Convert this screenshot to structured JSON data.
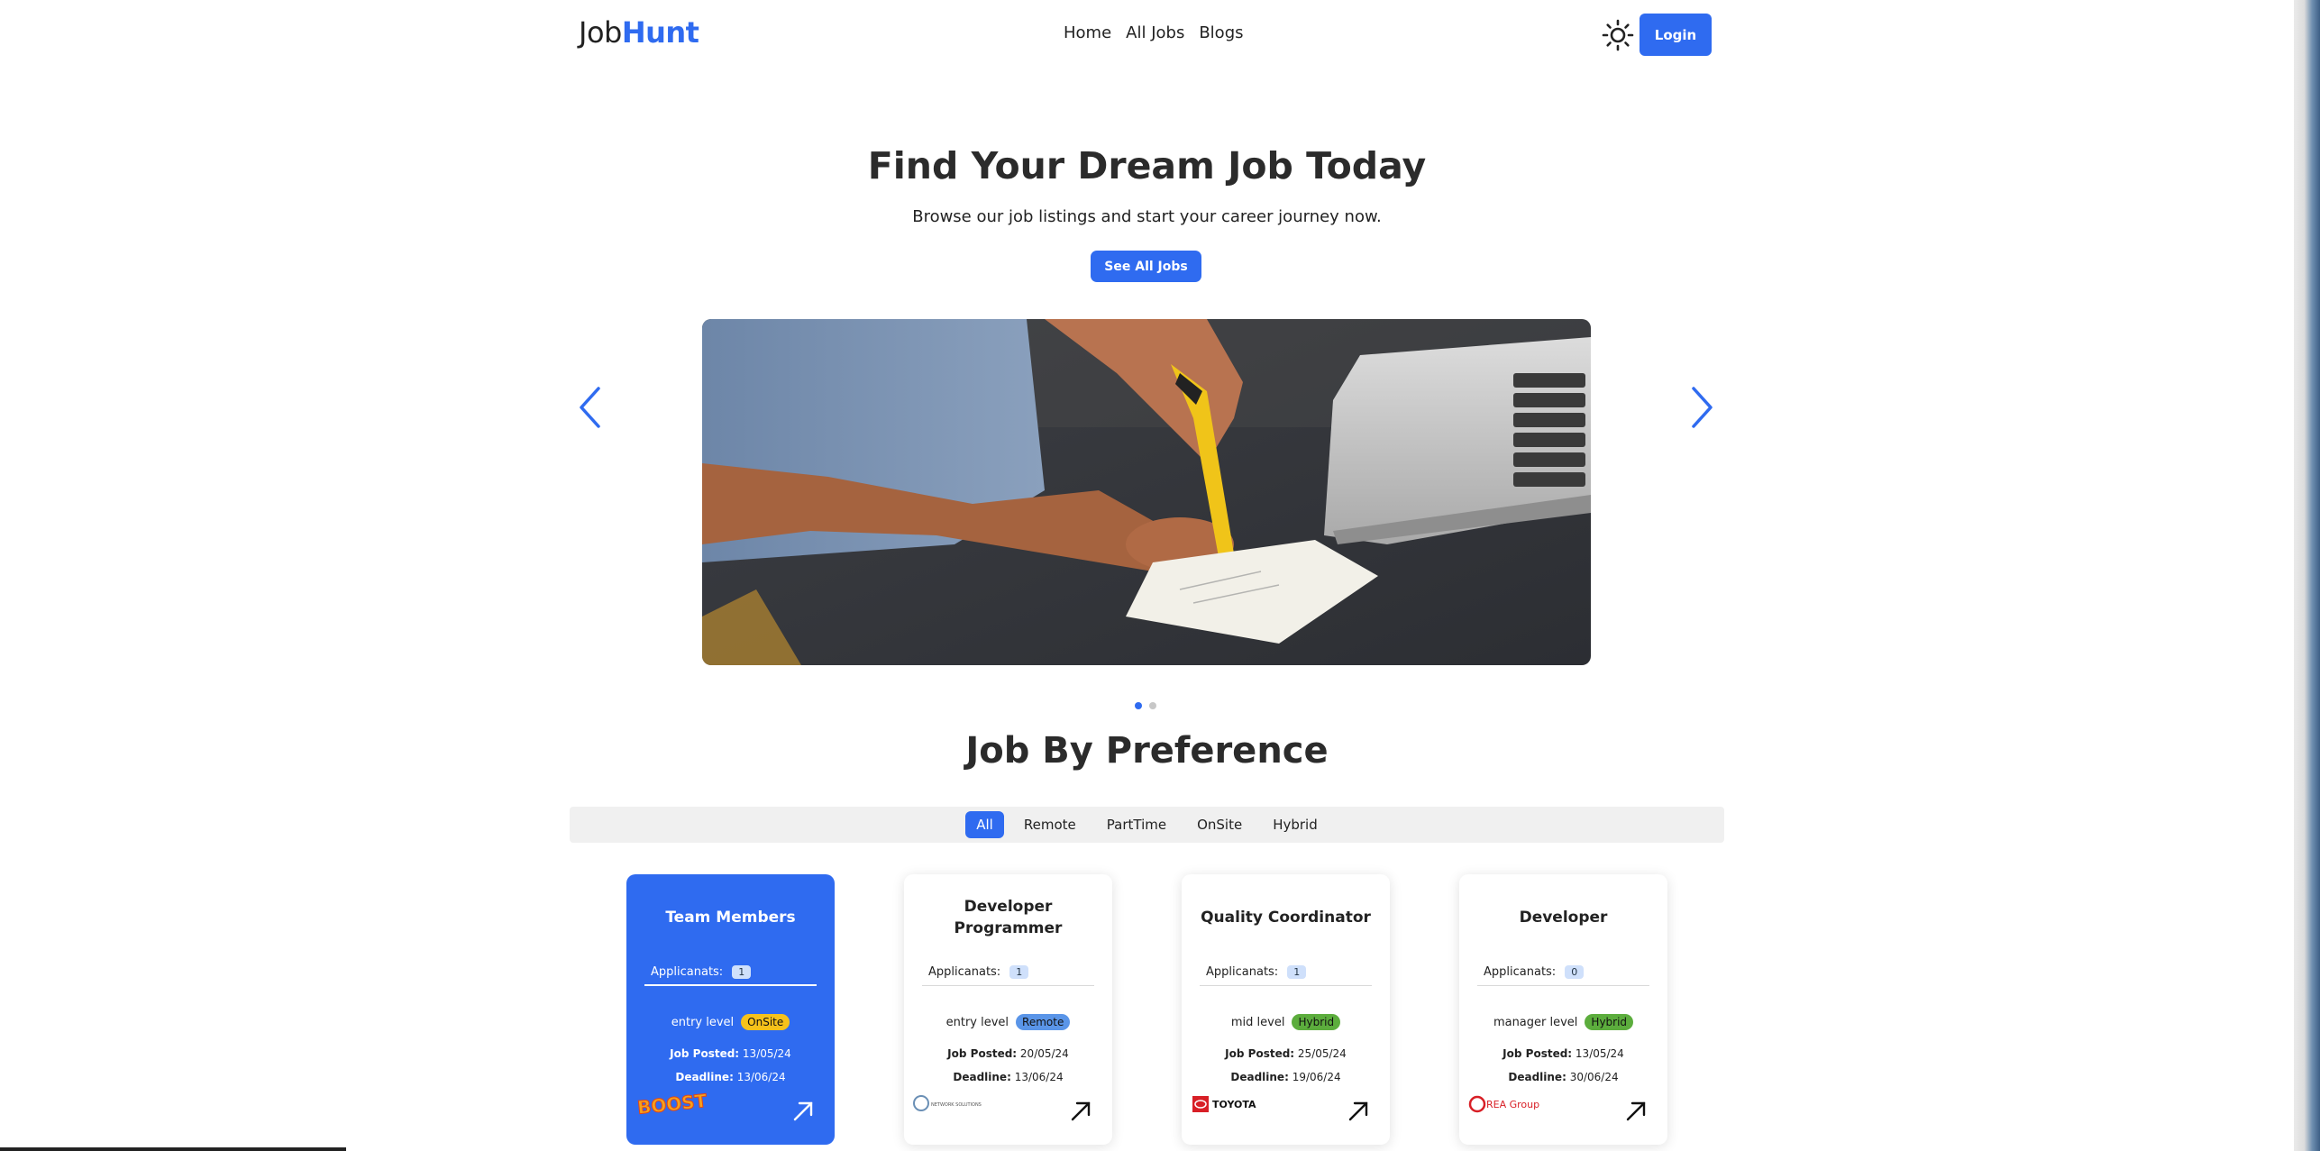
{
  "brand": {
    "part1": "Job",
    "part2": "Hunt",
    "accent_color": "#2f6bf0"
  },
  "nav": {
    "items": [
      "Home",
      "All Jobs",
      "Blogs"
    ]
  },
  "header": {
    "theme_icon": "sun-icon",
    "login_label": "Login"
  },
  "hero": {
    "title": "Find Your Dream Job Today",
    "subtitle": "Browse our job listings and start your career journey now.",
    "button_label": "See All Jobs"
  },
  "carousel": {
    "prev_icon": "chevron-left-icon",
    "next_icon": "chevron-right-icon",
    "slide_count": 2,
    "active_slide": 1
  },
  "preferences": {
    "title": "Job By Preference",
    "filters": [
      "All",
      "Remote",
      "PartTime",
      "OnSite",
      "Hybrid"
    ],
    "active_filter": "All"
  },
  "jobs": [
    {
      "title": "Team Members",
      "applicants_label": "Applicanats:",
      "applicants": "1",
      "level": "entry level",
      "type": "OnSite",
      "posted_label": "Job Posted:",
      "posted": "13/05/24",
      "deadline_label": "Deadline:",
      "deadline": "13/06/24",
      "company_logo": "BOOST"
    },
    {
      "title": "Developer Programmer",
      "applicants_label": "Applicanats:",
      "applicants": "1",
      "level": "entry level",
      "type": "Remote",
      "posted_label": "Job Posted:",
      "posted": "20/05/24",
      "deadline_label": "Deadline:",
      "deadline": "13/06/24",
      "company_logo": "NETWORK SOLUTIONS"
    },
    {
      "title": "Quality Coordinator",
      "applicants_label": "Applicanats:",
      "applicants": "1",
      "level": "mid level",
      "type": "Hybrid",
      "posted_label": "Job Posted:",
      "posted": "25/05/24",
      "deadline_label": "Deadline:",
      "deadline": "19/06/24",
      "company_logo": "TOYOTA"
    },
    {
      "title": "Developer",
      "applicants_label": "Applicanats:",
      "applicants": "0",
      "level": "manager level",
      "type": "Hybrid",
      "posted_label": "Job Posted:",
      "posted": "13/05/24",
      "deadline_label": "Deadline:",
      "deadline": "30/06/24",
      "company_logo": "REA Group"
    }
  ]
}
